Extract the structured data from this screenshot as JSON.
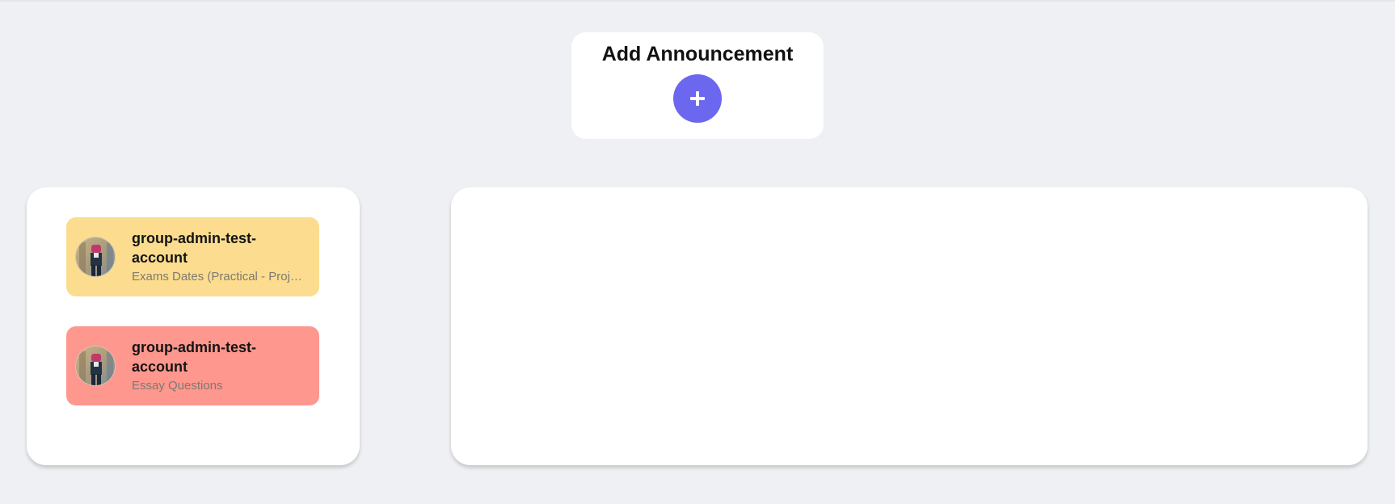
{
  "add_announcement": {
    "title": "Add Announcement",
    "button_icon": "plus-icon",
    "button_color": "#6b67ef"
  },
  "announcements": [
    {
      "author": "group-admin-test-account",
      "subtitle": "Exams Dates (Practical - Projects)",
      "background": "#fcdc8e",
      "avatar_icon": "user-avatar"
    },
    {
      "author": "group-admin-test-account",
      "subtitle": "Essay Questions",
      "background": "#fe978d",
      "avatar_icon": "user-avatar"
    }
  ]
}
